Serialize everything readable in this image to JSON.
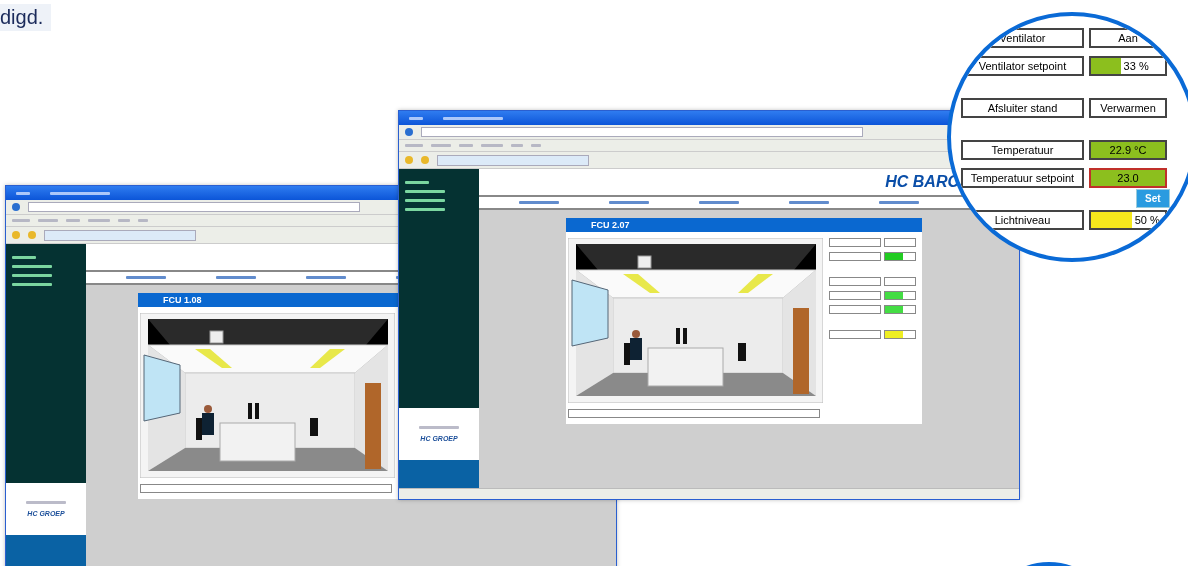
{
  "caption": {
    "text": "digd."
  },
  "windows": [
    {
      "panel_title": "FCU 1.08",
      "sidebar_logo": "HC GROEP"
    },
    {
      "panel_title": "FCU 2.07",
      "sidebar_logo": "HC GROEP",
      "header_logo": "HC BARC"
    }
  ],
  "zoom_circle": {
    "groups": [
      [
        {
          "kind": "text",
          "label": "Ventilator",
          "value": "Aan"
        },
        {
          "kind": "level",
          "label": "Ventilator setpoint",
          "value": "33 %",
          "level": 0.4,
          "color": "#8cbf1e"
        }
      ],
      [
        {
          "kind": "text",
          "label": "Afsluiter stand",
          "value": "Verwarmen"
        }
      ],
      [
        {
          "kind": "reading",
          "label": "Temperatuur",
          "value": "22.9 °C",
          "color": "#8cbf1e"
        },
        {
          "kind": "input",
          "label": "Temperatuur setpoint",
          "value": "23.0",
          "color": "#8cbf1e",
          "button": "Set"
        }
      ],
      [
        {
          "kind": "level",
          "label": "Lichtniveau",
          "value": "50 %",
          "level": 0.55,
          "color": "#f5e81c"
        }
      ]
    ]
  }
}
